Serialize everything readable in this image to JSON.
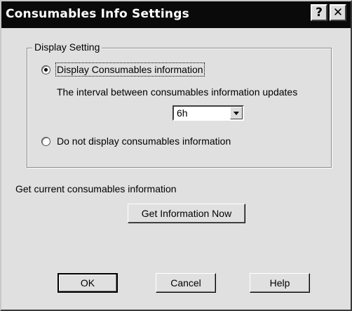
{
  "window": {
    "title": "Consumables Info Settings",
    "help_glyph": "?",
    "close_glyph": "✕"
  },
  "display_setting": {
    "group_label": "Display Setting",
    "option_display_label": "Display Consumables information",
    "option_display_selected": true,
    "interval_label": "The interval between consumables information updates",
    "interval_value": "6h",
    "option_hide_label": "Do not display consumables information",
    "option_hide_selected": false
  },
  "get_info": {
    "label": "Get current consumables information",
    "button_label": "Get Information Now"
  },
  "buttons": {
    "ok_label": "OK",
    "cancel_label": "Cancel",
    "help_label": "Help"
  }
}
